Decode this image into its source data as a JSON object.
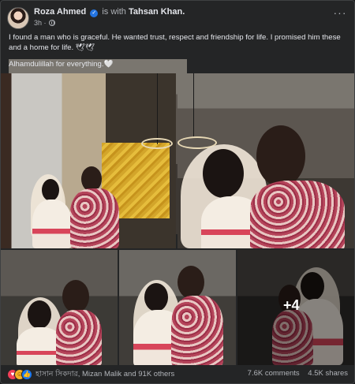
{
  "post": {
    "author": "Roza Ahmed",
    "is_with": "is with",
    "tagged": "Tahsan Khan.",
    "time": "3h ·",
    "more": "···",
    "text_line1": "I found a man who is graceful. He wanted trust, respect and friendship for life. I promised him these and a home for life. 🕊🕊",
    "text_line2": "Alhamdulillah for everything.🤍"
  },
  "photos": {
    "extra_count": "+4"
  },
  "footer": {
    "reactions": [
      "love",
      "care",
      "like"
    ],
    "reaction_names": "হাসান সিকদার, Mizan Malik and 91K others",
    "comments": "7.6K comments",
    "shares": "4.5K shares"
  },
  "colors": {
    "background": "#242526",
    "text_primary": "#e4e6eb",
    "text_secondary": "#b0b3b8",
    "verified_blue": "#2374e1"
  }
}
